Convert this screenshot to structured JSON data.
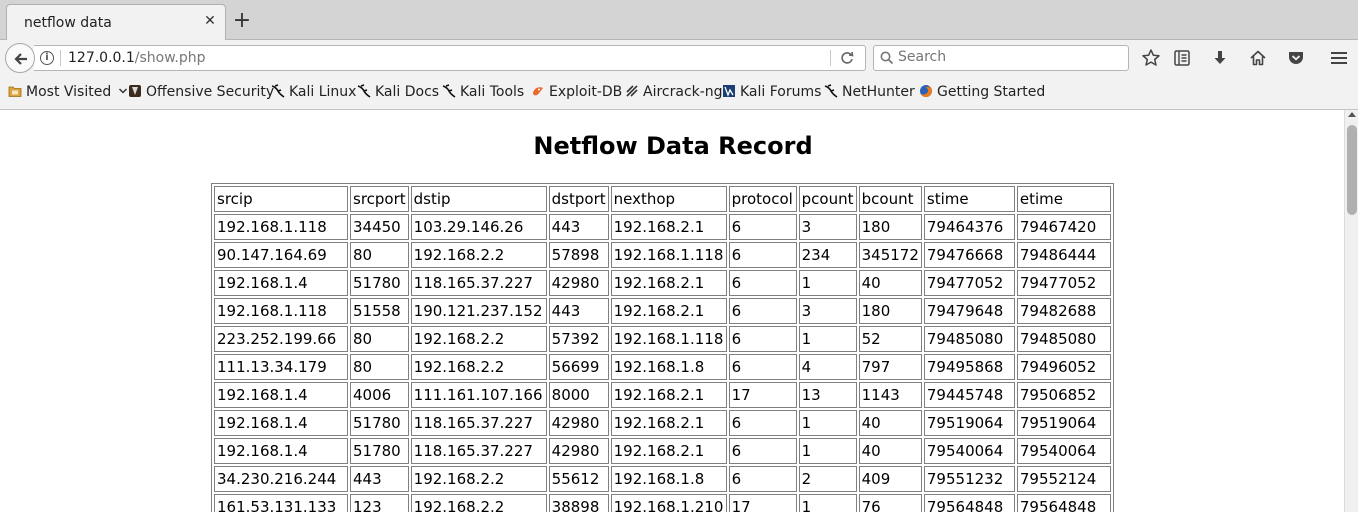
{
  "tab": {
    "title": "netflow data"
  },
  "navbar": {
    "url_host": "127.0.0.1",
    "url_path": "/show.php",
    "search_placeholder": "Search"
  },
  "bookmarks": [
    {
      "label": "Most Visited",
      "icon": "folder-icon"
    },
    {
      "label": "Offensive Security",
      "icon": "offsec-icon"
    },
    {
      "label": "Kali Linux",
      "icon": "kali-dragon-icon"
    },
    {
      "label": "Kali Docs",
      "icon": "kali-dragon-icon"
    },
    {
      "label": "Kali Tools",
      "icon": "kali-dragon-icon"
    },
    {
      "label": "Exploit-DB",
      "icon": "exploitdb-icon"
    },
    {
      "label": "Aircrack-ng",
      "icon": "aircrack-icon"
    },
    {
      "label": "Kali Forums",
      "icon": "kali-forums-icon"
    },
    {
      "label": "NetHunter",
      "icon": "kali-dragon-icon"
    },
    {
      "label": "Getting Started",
      "icon": "firefox-icon"
    }
  ],
  "page": {
    "title": "Netflow Data Record",
    "columns": [
      "srcip",
      "srcport",
      "dstip",
      "dstport",
      "nexthop",
      "protocol",
      "pcount",
      "bcount",
      "stime",
      "etime"
    ],
    "rows": [
      [
        "192.168.1.118",
        "34450",
        "103.29.146.26",
        "443",
        "192.168.2.1",
        "6",
        "3",
        "180",
        "79464376",
        "79467420"
      ],
      [
        "90.147.164.69",
        "80",
        "192.168.2.2",
        "57898",
        "192.168.1.118",
        "6",
        "234",
        "345172",
        "79476668",
        "79486444"
      ],
      [
        "192.168.1.4",
        "51780",
        "118.165.37.227",
        "42980",
        "192.168.2.1",
        "6",
        "1",
        "40",
        "79477052",
        "79477052"
      ],
      [
        "192.168.1.118",
        "51558",
        "190.121.237.152",
        "443",
        "192.168.2.1",
        "6",
        "3",
        "180",
        "79479648",
        "79482688"
      ],
      [
        "223.252.199.66",
        "80",
        "192.168.2.2",
        "57392",
        "192.168.1.118",
        "6",
        "1",
        "52",
        "79485080",
        "79485080"
      ],
      [
        "111.13.34.179",
        "80",
        "192.168.2.2",
        "56699",
        "192.168.1.8",
        "6",
        "4",
        "797",
        "79495868",
        "79496052"
      ],
      [
        "192.168.1.4",
        "4006",
        "111.161.107.166",
        "8000",
        "192.168.2.1",
        "17",
        "13",
        "1143",
        "79445748",
        "79506852"
      ],
      [
        "192.168.1.4",
        "51780",
        "118.165.37.227",
        "42980",
        "192.168.2.1",
        "6",
        "1",
        "40",
        "79519064",
        "79519064"
      ],
      [
        "192.168.1.4",
        "51780",
        "118.165.37.227",
        "42980",
        "192.168.2.1",
        "6",
        "1",
        "40",
        "79540064",
        "79540064"
      ],
      [
        "34.230.216.244",
        "443",
        "192.168.2.2",
        "55612",
        "192.168.1.8",
        "6",
        "2",
        "409",
        "79551232",
        "79552124"
      ],
      [
        "161.53.131.133",
        "123",
        "192.168.2.2",
        "38898",
        "192.168.1.210",
        "17",
        "1",
        "76",
        "79564848",
        "79564848"
      ]
    ]
  }
}
